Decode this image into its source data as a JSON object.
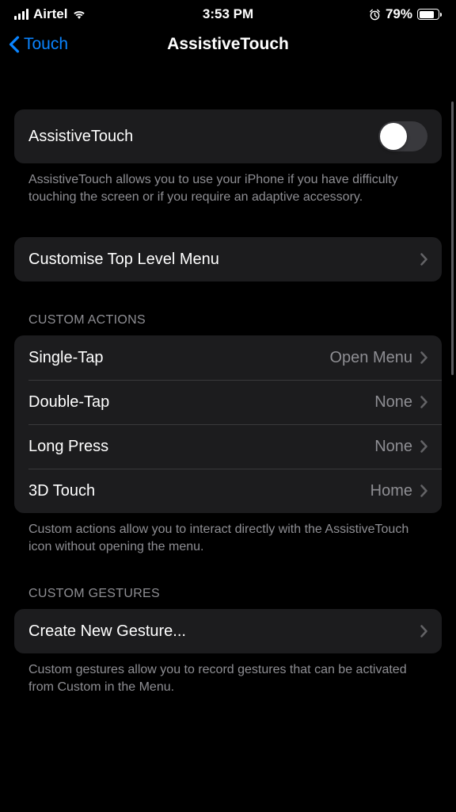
{
  "status_bar": {
    "carrier": "Airtel",
    "time": "3:53 PM",
    "battery_pct": "79%"
  },
  "nav": {
    "back_label": "Touch",
    "title": "AssistiveTouch"
  },
  "toggle_section": {
    "label": "AssistiveTouch",
    "footer": "AssistiveTouch allows you to use your iPhone if you have difficulty touching the screen or if you require an adaptive accessory."
  },
  "customise_row": {
    "label": "Customise Top Level Menu"
  },
  "custom_actions": {
    "header": "CUSTOM ACTIONS",
    "rows": [
      {
        "label": "Single-Tap",
        "value": "Open Menu"
      },
      {
        "label": "Double-Tap",
        "value": "None"
      },
      {
        "label": "Long Press",
        "value": "None"
      },
      {
        "label": "3D Touch",
        "value": "Home"
      }
    ],
    "footer": "Custom actions allow you to interact directly with the AssistiveTouch icon without opening the menu."
  },
  "custom_gestures": {
    "header": "CUSTOM GESTURES",
    "row_label": "Create New Gesture...",
    "footer": "Custom gestures allow you to record gestures that can be activated from Custom in the Menu."
  }
}
